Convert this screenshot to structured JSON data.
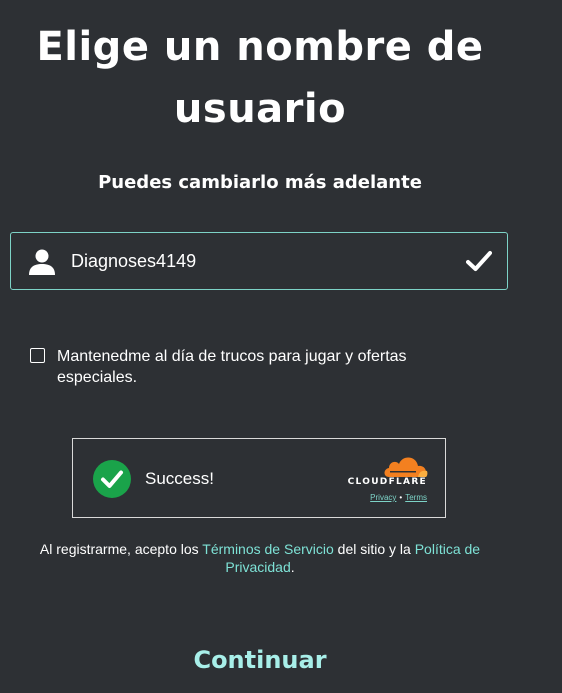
{
  "header": {
    "title_line1": "Elige un nombre de",
    "title_line2": "usuario",
    "subtitle": "Puedes cambiarlo más adelante"
  },
  "username": {
    "value": "Diagnoses4149",
    "icons": {
      "leading": "user-icon",
      "trailing": "check-icon"
    }
  },
  "newsletter": {
    "label": "Mantenedme al día de trucos para jugar y ofertas especiales.",
    "checked": false
  },
  "captcha": {
    "status_text": "Success!",
    "brand": "CLOUDFLARE",
    "privacy_link": "Privacy",
    "separator": "•",
    "terms_link": "Terms",
    "colors": {
      "success": "#1aa34a",
      "brand": "#f38020"
    }
  },
  "legal": {
    "prefix": "Al registrarme, acepto los ",
    "terms_link": "Términos de Servicio",
    "middle": " del sitio y la ",
    "privacy_link": "Política de Privacidad",
    "suffix": "."
  },
  "actions": {
    "continue_label": "Continuar"
  },
  "theme": {
    "background": "#2d3034",
    "accent": "#7ee2d6"
  }
}
